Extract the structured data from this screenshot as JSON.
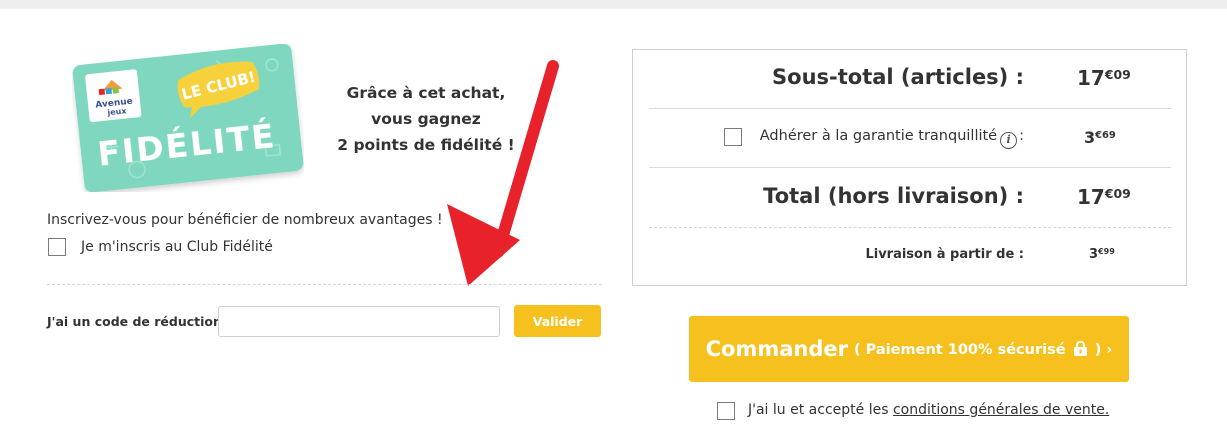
{
  "loyalty": {
    "card": {
      "brand_line1": "Avenue",
      "brand_line2": "jeux",
      "badge": "LE CLUB!",
      "title": "FIDÉLITÉ"
    },
    "pitch": [
      "Grâce à cet achat,",
      "vous gagnez",
      "2 points de fidélité !"
    ],
    "invite": "Inscrivez-vous pour bénéficier de nombreux avantages !",
    "signup_label": "Je m'inscris au Club Fidélité"
  },
  "promo": {
    "label": "J'ai un code de réduction :",
    "input_value": "",
    "button": "Valider"
  },
  "summary": {
    "subtotal_label": "Sous-total (articles) :",
    "subtotal_int": "17",
    "subtotal_dec": "€09",
    "warranty_label": "Adhérer à la garantie tranquillité",
    "warranty_colon": ":",
    "warranty_int": "3",
    "warranty_dec": "€69",
    "total_label": "Total (hors livraison) :",
    "total_int": "17",
    "total_dec": "€09",
    "shipping_label": "Livraison à partir de :",
    "shipping_int": "3",
    "shipping_dec": "€99"
  },
  "order": {
    "main": "Commander",
    "sub_open": "( Paiement 100% sécurisé",
    "sub_close": ") ›"
  },
  "cgv": {
    "prefix": "J'ai lu et accepté les",
    "link": "conditions générales de vente."
  },
  "colors": {
    "accent": "#f6c11f",
    "card": "#7ed7be",
    "arrow": "#e8222a",
    "badge": "#f6d13a"
  }
}
